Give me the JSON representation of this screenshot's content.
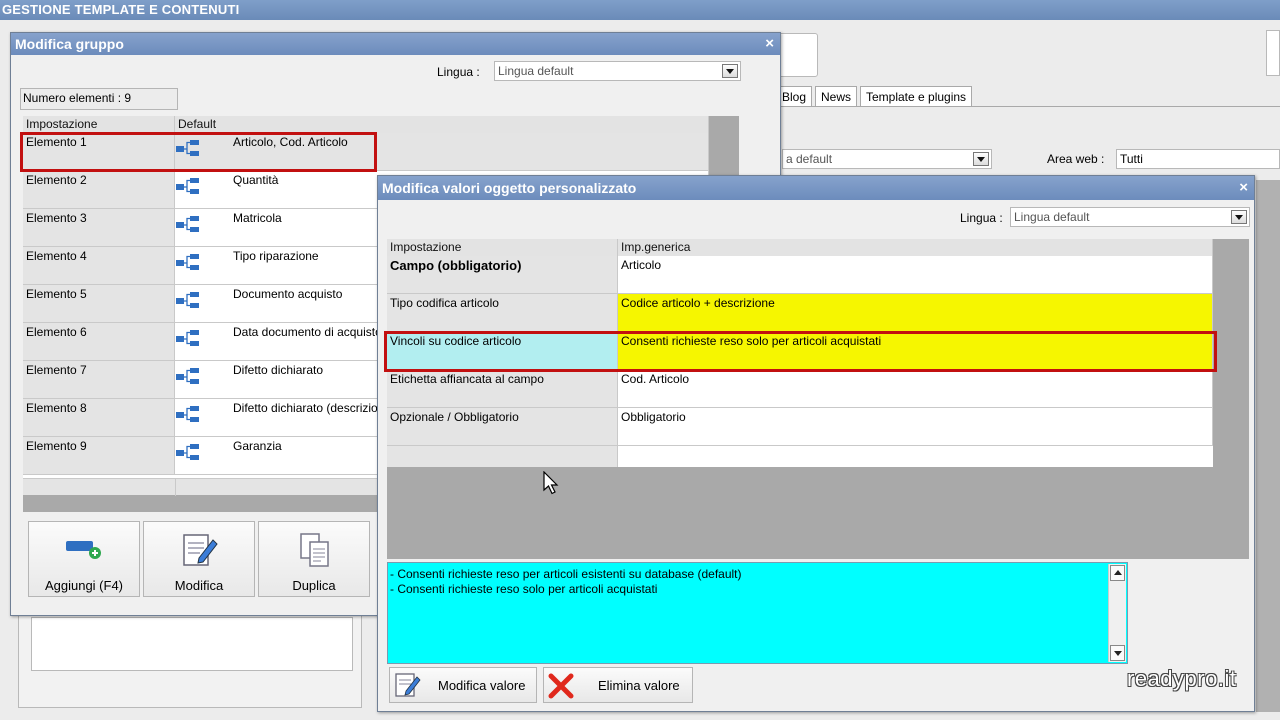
{
  "app": {
    "title": "GESTIONE TEMPLATE E CONTENUTI",
    "tabs": [
      "Blog",
      "News",
      "Template e plugins"
    ],
    "lang_select_partial": "a default",
    "area_web_label": "Area web :",
    "area_web_value": "Tutti"
  },
  "dlg_group": {
    "title": "Modifica gruppo",
    "close": "×",
    "lingua_label": "Lingua :",
    "lingua_value": "Lingua default",
    "count_text": "Numero elementi : 9",
    "col_setting": "Impostazione",
    "col_default": "Default",
    "rows": [
      {
        "name": "Elemento 1",
        "value": "Articolo, Cod. Articolo"
      },
      {
        "name": "Elemento 2",
        "value": "Quantità"
      },
      {
        "name": "Elemento 3",
        "value": "Matricola"
      },
      {
        "name": "Elemento 4",
        "value": "Tipo riparazione"
      },
      {
        "name": "Elemento 5",
        "value": "Documento acquisto"
      },
      {
        "name": "Elemento 6",
        "value": "Data documento di acquisto"
      },
      {
        "name": "Elemento 7",
        "value": "Difetto dichiarato"
      },
      {
        "name": "Elemento 8",
        "value": "Difetto dichiarato (descrizione)"
      },
      {
        "name": "Elemento 9",
        "value": "Garanzia"
      }
    ],
    "buttons": {
      "add": "Aggiungi (F4)",
      "edit": "Modifica",
      "dup": "Duplica"
    }
  },
  "dlg_values": {
    "title": "Modifica valori oggetto personalizzato",
    "close": "×",
    "lingua_label": "Lingua :",
    "lingua_value": "Lingua default",
    "col_setting": "Impostazione",
    "col_value": "Imp.generica",
    "rows": [
      {
        "name": "Campo (obbligatorio)",
        "value": "Articolo",
        "bold": true
      },
      {
        "name": "Tipo codifica articolo",
        "value": "Codice articolo + descrizione"
      },
      {
        "name": "Vincoli su codice articolo",
        "value": "Consenti richieste reso solo per articoli acquistati"
      },
      {
        "name": "Etichetta affiancata al campo",
        "value": "Cod. Articolo"
      },
      {
        "name": "Opzionale / Obbligatorio",
        "value": "Obbligatorio"
      }
    ],
    "options": [
      "- Consenti richieste reso per articoli esistenti su database (default)",
      "- Consenti richieste reso solo per articoli acquistati"
    ],
    "btn_edit": "Modifica valore",
    "btn_delete": "Elimina valore"
  },
  "watermark": "readypro.it",
  "colors": {
    "highlight": "#c21010",
    "yellow": "#f6f600",
    "cyan": "#00ffff",
    "titlebar": "#6c8cbc"
  }
}
